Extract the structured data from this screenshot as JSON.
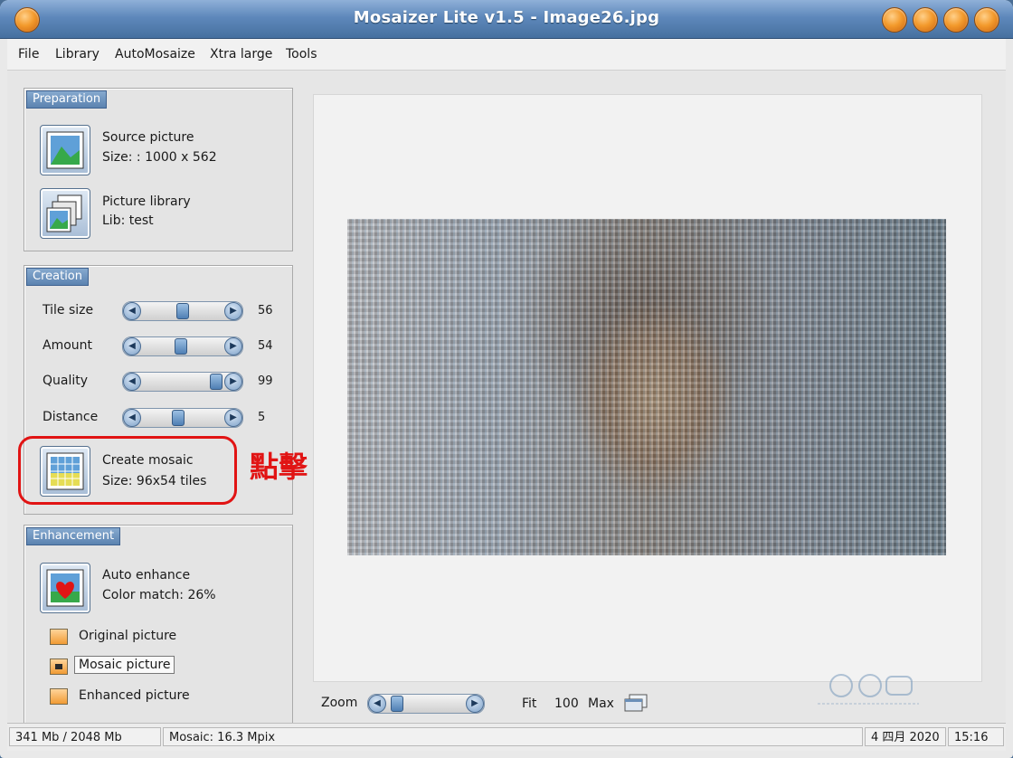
{
  "window": {
    "title": "Mosaizer Lite v1.5 - Image26.jpg"
  },
  "menu": [
    "File",
    "Library",
    "AutoMosaize",
    "Xtra large",
    "Tools"
  ],
  "preparation": {
    "title": "Preparation",
    "source": {
      "label": "Source picture",
      "size": "Size: : 1000 x 562"
    },
    "library": {
      "label": "Picture library",
      "lib": "Lib: test"
    }
  },
  "creation": {
    "title": "Creation",
    "sliders": [
      {
        "label": "Tile size",
        "value": "56",
        "position": 0.5
      },
      {
        "label": "Amount",
        "value": "54",
        "position": 0.48
      },
      {
        "label": "Quality",
        "value": "99",
        "position": 0.98
      },
      {
        "label": "Distance",
        "value": "5",
        "position": 0.44
      }
    ],
    "create": {
      "label": "Create mosaic",
      "size": "Size:  96x54 tiles"
    }
  },
  "annotation": {
    "text": "點擊",
    "color": "#e11414"
  },
  "enhancement": {
    "title": "Enhancement",
    "auto": {
      "label": "Auto enhance",
      "match": "Color match:  26%"
    },
    "options": [
      {
        "label": "Original picture",
        "checked": false
      },
      {
        "label": "Mosaic picture",
        "checked": true
      },
      {
        "label": "Enhanced picture",
        "checked": false
      }
    ]
  },
  "zoom": {
    "label": "Zoom",
    "fit": "Fit",
    "value": "100",
    "max": "Max",
    "position": 0.07
  },
  "status": {
    "memory": "341 Mb / 2048 Mb",
    "mosaic": "Mosaic: 16.3 Mpix",
    "date": "4 四月 2020",
    "time": "15:16"
  },
  "colors": {
    "titlebar": "#5e88bb",
    "accent": "#f39a2c",
    "annotation": "#e11414"
  }
}
